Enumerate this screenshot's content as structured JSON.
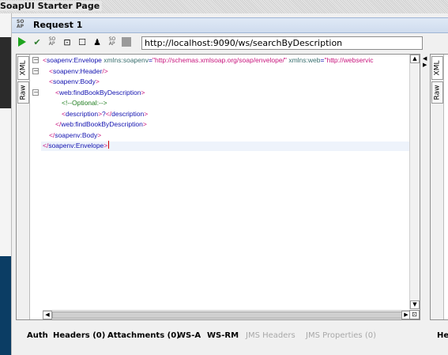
{
  "app": {
    "title": "SoapUI Starter Page"
  },
  "request": {
    "title": "Request 1",
    "url": "http://localhost:9090/ws/searchByDescription"
  },
  "editor_tabs": [
    "XML",
    "Raw"
  ],
  "code_lines": [
    {
      "parts": [
        [
          "brk",
          "<"
        ],
        [
          "tag",
          "soapenv:Envelope "
        ],
        [
          "attr",
          "xmlns:soapenv"
        ],
        [
          "tag",
          "="
        ],
        [
          "val",
          "\"http://schemas.xmlsoap.org/soap/envelope/\""
        ],
        [
          "tag",
          " "
        ],
        [
          "attr",
          "xmlns:web"
        ],
        [
          "tag",
          "="
        ],
        [
          "val",
          "\"http://webservic"
        ]
      ]
    },
    {
      "parts": [
        [
          "brk",
          "<"
        ],
        [
          "tag",
          "soapenv:Header"
        ],
        [
          "brk",
          "/>"
        ]
      ]
    },
    {
      "parts": [
        [
          "brk",
          "<"
        ],
        [
          "tag",
          "soapenv:Body"
        ],
        [
          "brk",
          ">"
        ]
      ]
    },
    {
      "parts": [
        [
          "brk",
          "<"
        ],
        [
          "tag",
          "web:findBookByDescription"
        ],
        [
          "brk",
          ">"
        ]
      ]
    },
    {
      "parts": [
        [
          "cmt",
          "<!--Optional:-->"
        ]
      ]
    },
    {
      "parts": [
        [
          "brk",
          "<"
        ],
        [
          "tag",
          "description"
        ],
        [
          "brk",
          ">"
        ],
        [
          "tag",
          "?"
        ],
        [
          "brk",
          "</"
        ],
        [
          "tag",
          "description"
        ],
        [
          "brk",
          ">"
        ]
      ]
    },
    {
      "parts": [
        [
          "brk",
          "</"
        ],
        [
          "tag",
          "web:findBookByDescription"
        ],
        [
          "brk",
          ">"
        ]
      ]
    },
    {
      "parts": [
        [
          "brk",
          "</"
        ],
        [
          "tag",
          "soapenv:Body"
        ],
        [
          "brk",
          ">"
        ]
      ]
    },
    {
      "parts": [
        [
          "brk",
          "</"
        ],
        [
          "tag",
          "soapenv:Envelope"
        ],
        [
          "brk",
          ">"
        ]
      ]
    }
  ],
  "bottom_tabs": [
    {
      "label": "Auth",
      "enabled": true
    },
    {
      "label": "Headers (0)",
      "enabled": true
    },
    {
      "label": "Attachments (0)",
      "enabled": true
    },
    {
      "label": "WS-A",
      "enabled": true
    },
    {
      "label": "WS-RM",
      "enabled": true
    },
    {
      "label": "JMS Headers",
      "enabled": false
    },
    {
      "label": "JMS Properties (0)",
      "enabled": false
    }
  ],
  "right_pane": {
    "tabs": [
      "XML",
      "Raw"
    ],
    "bottom_tab_partial": "He"
  },
  "toolbar_icons": [
    "run-icon",
    "run-validate-icon",
    "soap-icon",
    "config-icon",
    "stop-icon",
    "user-icon",
    "soap-icon-2",
    "gray-icon"
  ]
}
